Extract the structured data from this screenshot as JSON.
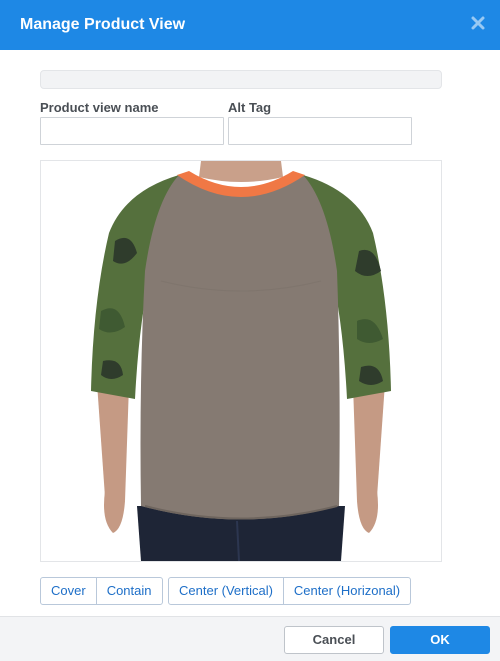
{
  "dialog": {
    "title": "Manage Product View",
    "close_icon": "close-x-icon"
  },
  "form": {
    "view_name": {
      "label": "Product view name",
      "value": ""
    },
    "alt_tag": {
      "label": "Alt Tag",
      "value": ""
    }
  },
  "preview": {
    "image_subject": "raglan-tshirt-product-photo"
  },
  "fit_buttons": [
    "Cover",
    "Contain"
  ],
  "align_buttons": [
    "Center (Vertical)",
    "Center (Horizonal)"
  ],
  "footer": {
    "cancel_label": "Cancel",
    "ok_label": "OK"
  },
  "colors": {
    "accent": "#1e88e5",
    "link_text": "#1e6fc8",
    "shirt_body": "#857a72",
    "sleeve_camo": "#55703d",
    "collar": "#f07845"
  }
}
